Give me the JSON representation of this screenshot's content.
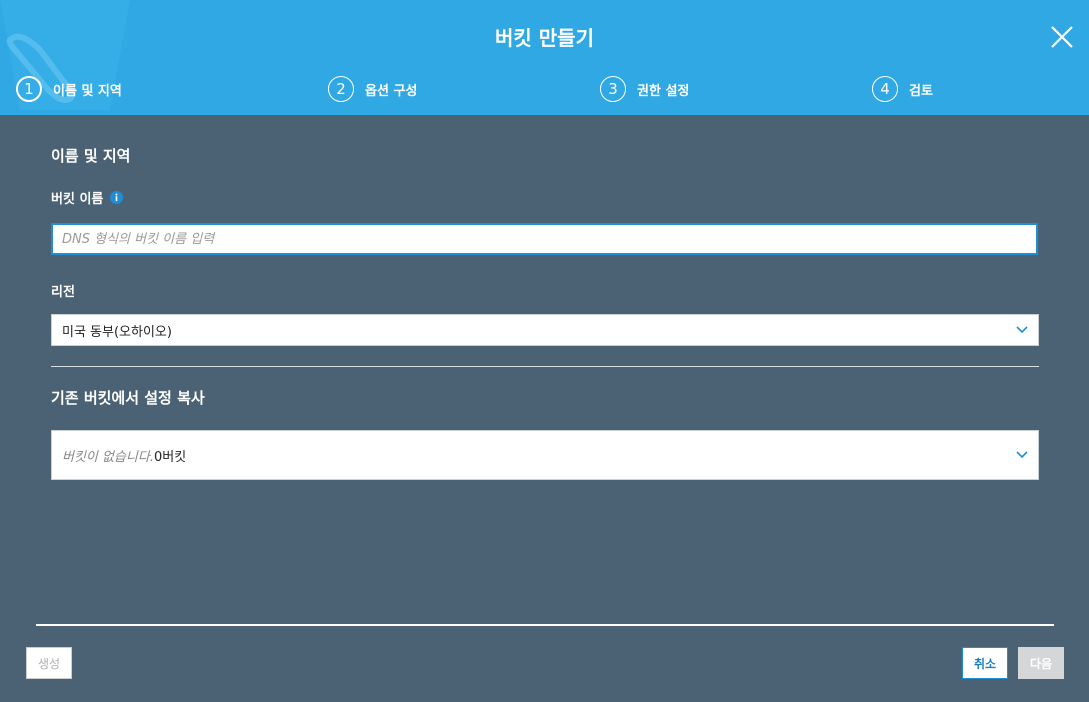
{
  "dialog": {
    "title": "버킷 만들기",
    "close_icon": "close-icon"
  },
  "steps": [
    {
      "number": "1",
      "label": "이름 및 지역",
      "active": true
    },
    {
      "number": "2",
      "label": "옵션 구성",
      "active": false
    },
    {
      "number": "3",
      "label": "권한 설정",
      "active": false
    },
    {
      "number": "4",
      "label": "검토",
      "active": false
    }
  ],
  "name_region": {
    "section_title": "이름 및 지역",
    "bucket_name_label": "버킷 이름",
    "bucket_name_value": "",
    "bucket_name_placeholder": "DNS 형식의 버킷 이름 입력",
    "region_label": "리전",
    "region_value": "미국 동부(오하이오)"
  },
  "copy_settings": {
    "title": "기존 버킷에서 설정 복사",
    "placeholder": "버킷이 없습니다.",
    "count_text": "0버킷"
  },
  "footer": {
    "create_label": "생성",
    "cancel_label": "취소",
    "next_label": "다음"
  },
  "colors": {
    "header_bg": "#2fa8e4",
    "body_bg": "#4a6274",
    "input_border": "#1f8ed6",
    "info_icon": "#1f8ed6"
  }
}
